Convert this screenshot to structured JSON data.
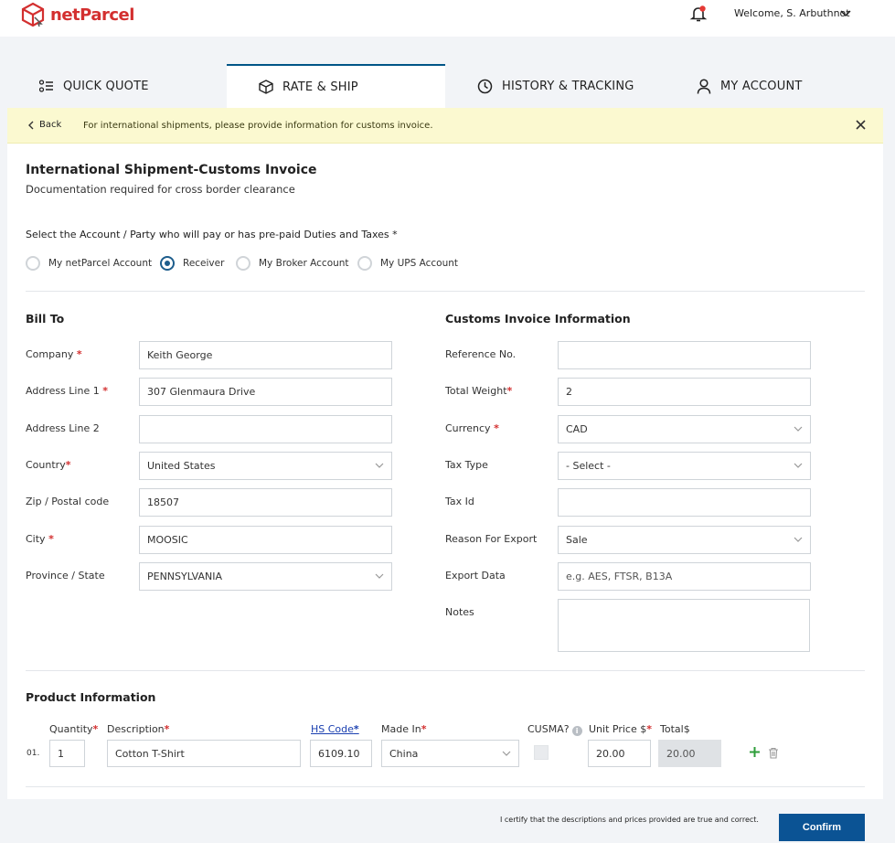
{
  "header": {
    "logo_text": "netParcel",
    "welcome": "Welcome, S. Arbuthnot",
    "brand_color": "#d32f2f",
    "notification_icon": "bell-icon"
  },
  "tabs": [
    {
      "label": "QUICK QUOTE",
      "icon": "list-icon",
      "active": false
    },
    {
      "label": "RATE & SHIP",
      "icon": "box-icon",
      "active": true
    },
    {
      "label": "HISTORY & TRACKING",
      "icon": "clock-icon",
      "active": false
    },
    {
      "label": "MY ACCOUNT",
      "icon": "user-icon",
      "active": false
    }
  ],
  "banner": {
    "back_label": "Back",
    "message": "For international shipments, please provide information for customs invoice."
  },
  "page": {
    "title": "International Shipment-Customs Invoice",
    "subtitle": "Documentation required for cross border clearance",
    "select_label": "Select the Account / Party who will pay or has pre-paid Duties and Taxes *"
  },
  "payer_options": [
    {
      "label": "My netParcel Account",
      "selected": false
    },
    {
      "label": "Receiver",
      "selected": true
    },
    {
      "label": "My Broker Account",
      "selected": false
    },
    {
      "label": "My UPS Account",
      "selected": false
    }
  ],
  "bill_to": {
    "heading": "Bill To",
    "company_label": "Company",
    "company_value": "Keith George",
    "address1_label": "Address Line 1",
    "address1_value": "307 Glenmaura Drive",
    "address2_label": "Address Line 2",
    "address2_value": "",
    "country_label": "Country",
    "country_value": "United States",
    "zip_label": "Zip / Postal code",
    "zip_value": "18507",
    "city_label": "City",
    "city_value": "MOOSIC",
    "province_label": "Province / State",
    "province_value": "PENNSYLVANIA"
  },
  "customs": {
    "heading": "Customs Invoice Information",
    "reference_label": "Reference No.",
    "reference_value": "",
    "weight_label": "Total Weight",
    "weight_value": "2",
    "currency_label": "Currency",
    "currency_value": "CAD",
    "taxtype_label": "Tax Type",
    "taxtype_value": "- Select -",
    "taxid_label": "Tax Id",
    "taxid_value": "",
    "reason_label": "Reason For Export",
    "reason_value": "Sale",
    "export_label": "Export Data",
    "export_placeholder": "e.g. AES, FTSR, B13A",
    "notes_label": "Notes",
    "notes_value": ""
  },
  "product": {
    "heading": "Product Information",
    "col_quantity": "Quantity",
    "col_description": "Description",
    "col_hscode": "HS Code",
    "col_madein": "Made In",
    "col_cusma": "CUSMA?",
    "col_unitprice": "Unit Price $",
    "col_total": "Total$",
    "row_number": "01.",
    "quantity": "1",
    "description": "Cotton T-Shirt",
    "hscode": "6109.10",
    "madein": "China",
    "cusma_checked": false,
    "unit_price": "20.00",
    "total": "20.00"
  },
  "footer": {
    "certify": "I certify that the descriptions and prices provided are true and correct.",
    "confirm_label": "Confirm"
  }
}
